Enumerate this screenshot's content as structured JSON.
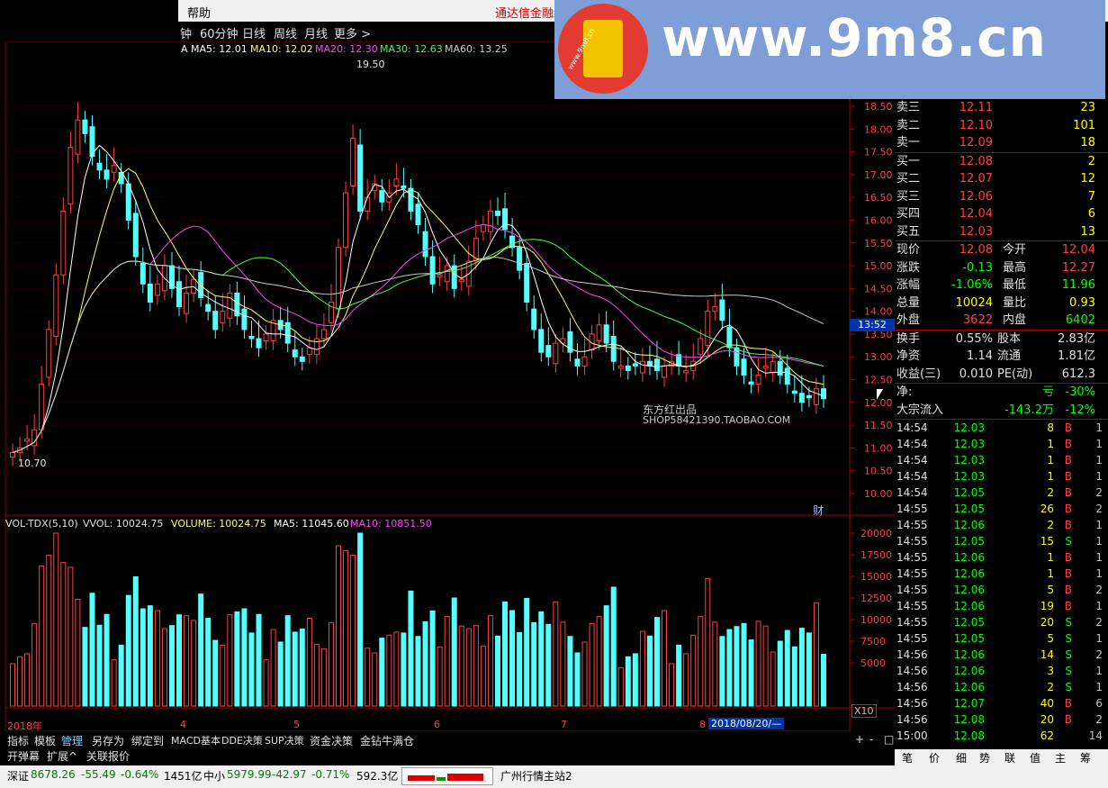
{
  "menu": {
    "help": "帮助",
    "banner": "通达信金融终"
  },
  "periods": [
    "钟",
    "60分钟",
    "日线",
    "周线",
    "月线",
    "更多 >"
  ],
  "watermark": {
    "text": "www.9m8.cn",
    "sub": "www.9m8.cn"
  },
  "main_chart": {
    "ma_prefix": "A",
    "ma": [
      {
        "label": "MA5: 12.01",
        "color": "#ffffff"
      },
      {
        "label": "MA10: 12.02",
        "color": "#ffff66"
      },
      {
        "label": "MA20: 12.30",
        "color": "#ff44ff"
      },
      {
        "label": "MA30: 12.63",
        "color": "#44ff44"
      },
      {
        "label": "MA60: 13.25",
        "color": "#cccccc"
      }
    ],
    "high_label": "19.50",
    "low_label": "10.70",
    "current_tag": "13:52",
    "fin_tag": "财",
    "watermark_text": "东方红出品",
    "watermark_shop": "SHOP58421390.TAOBAO.COM",
    "y_ticks": [
      "18.50",
      "18.00",
      "17.50",
      "17.00",
      "16.50",
      "16.00",
      "15.50",
      "15.00",
      "14.50",
      "14.00",
      "13.50",
      "13.00",
      "12.50",
      "12.00",
      "11.50",
      "11.00",
      "10.50",
      "10.00"
    ]
  },
  "vol_chart": {
    "title": "VOL-TDX(5,10)",
    "vvol": "VVOL: 10024.75",
    "volume": "VOLUME: 10024.75",
    "ma5": "MA5: 11045.60",
    "ma10": "MA10: 10851.50",
    "y_ticks": [
      "20000",
      "17500",
      "15000",
      "12500",
      "10000",
      "7500",
      "5000"
    ],
    "x10": "X10"
  },
  "x_axis": {
    "labels": [
      "2018年",
      "4",
      "5",
      "6",
      "7",
      "8"
    ],
    "cursor_date": "2018/08/20/—"
  },
  "order_book": {
    "asks": [
      {
        "label": "卖三",
        "price": "12.11",
        "vol": "23"
      },
      {
        "label": "卖二",
        "price": "12.10",
        "vol": "101"
      },
      {
        "label": "卖一",
        "price": "12.09",
        "vol": "18"
      }
    ],
    "bids": [
      {
        "label": "买一",
        "price": "12.08",
        "vol": "2"
      },
      {
        "label": "买二",
        "price": "12.07",
        "vol": "12"
      },
      {
        "label": "买三",
        "price": "12.06",
        "vol": "7"
      },
      {
        "label": "买四",
        "price": "12.04",
        "vol": "6"
      },
      {
        "label": "买五",
        "price": "12.03",
        "vol": "13"
      }
    ]
  },
  "stats": [
    {
      "l1": "现价",
      "v1": "12.08",
      "c1": "#ff4040",
      "l2": "今开",
      "v2": "12.04",
      "c2": "#ff4040"
    },
    {
      "l1": "涨跌",
      "v1": "-0.13",
      "c1": "#00ff00",
      "l2": "最高",
      "v2": "12.27",
      "c2": "#ff4040"
    },
    {
      "l1": "涨幅",
      "v1": "-1.06%",
      "c1": "#00ff00",
      "l2": "最低",
      "v2": "11.96",
      "c2": "#00ff00"
    },
    {
      "l1": "总量",
      "v1": "10024",
      "c1": "#ffff00",
      "l2": "量比",
      "v2": "0.93",
      "c2": "#ffff00"
    },
    {
      "l1": "外盘",
      "v1": "3622",
      "c1": "#ff4040",
      "l2": "内盘",
      "v2": "6402",
      "c2": "#00ff00"
    }
  ],
  "stats2": [
    {
      "l1": "换手",
      "v1": "0.55%",
      "l2": "股本",
      "v2": "2.83亿"
    },
    {
      "l1": "净资",
      "v1": "1.14",
      "l2": "流通",
      "v2": "1.81亿"
    },
    {
      "l1": "收益(三)",
      "v1": "0.010",
      "l2": "PE(动)",
      "v2": "612.3"
    }
  ],
  "flow": [
    {
      "l": "净:",
      "v1": "亏",
      "v2": "-30%"
    },
    {
      "l": "大宗流入",
      "v1": "-143.2万",
      "v2": "-12%"
    }
  ],
  "ticks": [
    {
      "t": "14:54",
      "p": "12.03",
      "v": "8",
      "s": "B",
      "n": "1"
    },
    {
      "t": "14:54",
      "p": "12.03",
      "v": "1",
      "s": "B",
      "n": "1"
    },
    {
      "t": "14:54",
      "p": "12.03",
      "v": "1",
      "s": "B",
      "n": "1"
    },
    {
      "t": "14:54",
      "p": "12.03",
      "v": "1",
      "s": "B",
      "n": "1"
    },
    {
      "t": "14:54",
      "p": "12.05",
      "v": "2",
      "s": "B",
      "n": "2"
    },
    {
      "t": "14:55",
      "p": "12.05",
      "v": "26",
      "s": "B",
      "n": "2"
    },
    {
      "t": "14:55",
      "p": "12.06",
      "v": "2",
      "s": "B",
      "n": "1"
    },
    {
      "t": "14:55",
      "p": "12.05",
      "v": "15",
      "s": "S",
      "n": "1"
    },
    {
      "t": "14:55",
      "p": "12.06",
      "v": "1",
      "s": "B",
      "n": "1"
    },
    {
      "t": "14:55",
      "p": "12.06",
      "v": "1",
      "s": "B",
      "n": "1"
    },
    {
      "t": "14:55",
      "p": "12.06",
      "v": "5",
      "s": "B",
      "n": "2"
    },
    {
      "t": "14:55",
      "p": "12.06",
      "v": "19",
      "s": "B",
      "n": "1"
    },
    {
      "t": "14:55",
      "p": "12.05",
      "v": "20",
      "s": "S",
      "n": "2"
    },
    {
      "t": "14:55",
      "p": "12.05",
      "v": "5",
      "s": "S",
      "n": "1"
    },
    {
      "t": "14:56",
      "p": "12.06",
      "v": "14",
      "s": "S",
      "n": "2"
    },
    {
      "t": "14:56",
      "p": "12.06",
      "v": "3",
      "s": "S",
      "n": "1"
    },
    {
      "t": "14:56",
      "p": "12.06",
      "v": "2",
      "s": "S",
      "n": "1"
    },
    {
      "t": "14:56",
      "p": "12.07",
      "v": "40",
      "s": "B",
      "n": "6"
    },
    {
      "t": "14:56",
      "p": "12.08",
      "v": "20",
      "s": "B",
      "n": "2"
    },
    {
      "t": "15:00",
      "p": "12.08",
      "v": "62",
      "s": "",
      "n": "14"
    }
  ],
  "tabs": [
    "指标",
    "模板",
    "管理",
    "另存为",
    "绑定到",
    "MACD基本",
    "DDE决策",
    "SUP决策",
    "资金决策",
    "金钻牛满仓"
  ],
  "tabs_right": [
    "+",
    "-",
    "□"
  ],
  "tabs2": [
    "开弹幕",
    "扩展^",
    "关联报价"
  ],
  "right_tabs": [
    "笔",
    "价",
    "细",
    "势",
    "联",
    "值",
    "主",
    "筹"
  ],
  "status": {
    "sz_label": "深证",
    "sz_value": "8678.26",
    "sz_change": "-55.49",
    "sz_pct": "-0.64%",
    "sz_amt": "1451亿",
    "zx_label": "中小",
    "zx_value": "5979.99",
    "zx_change": "-42.97",
    "zx_pct": "-0.71%",
    "zx_amt": "592.3亿",
    "msg": "广州行情主站2"
  }
}
